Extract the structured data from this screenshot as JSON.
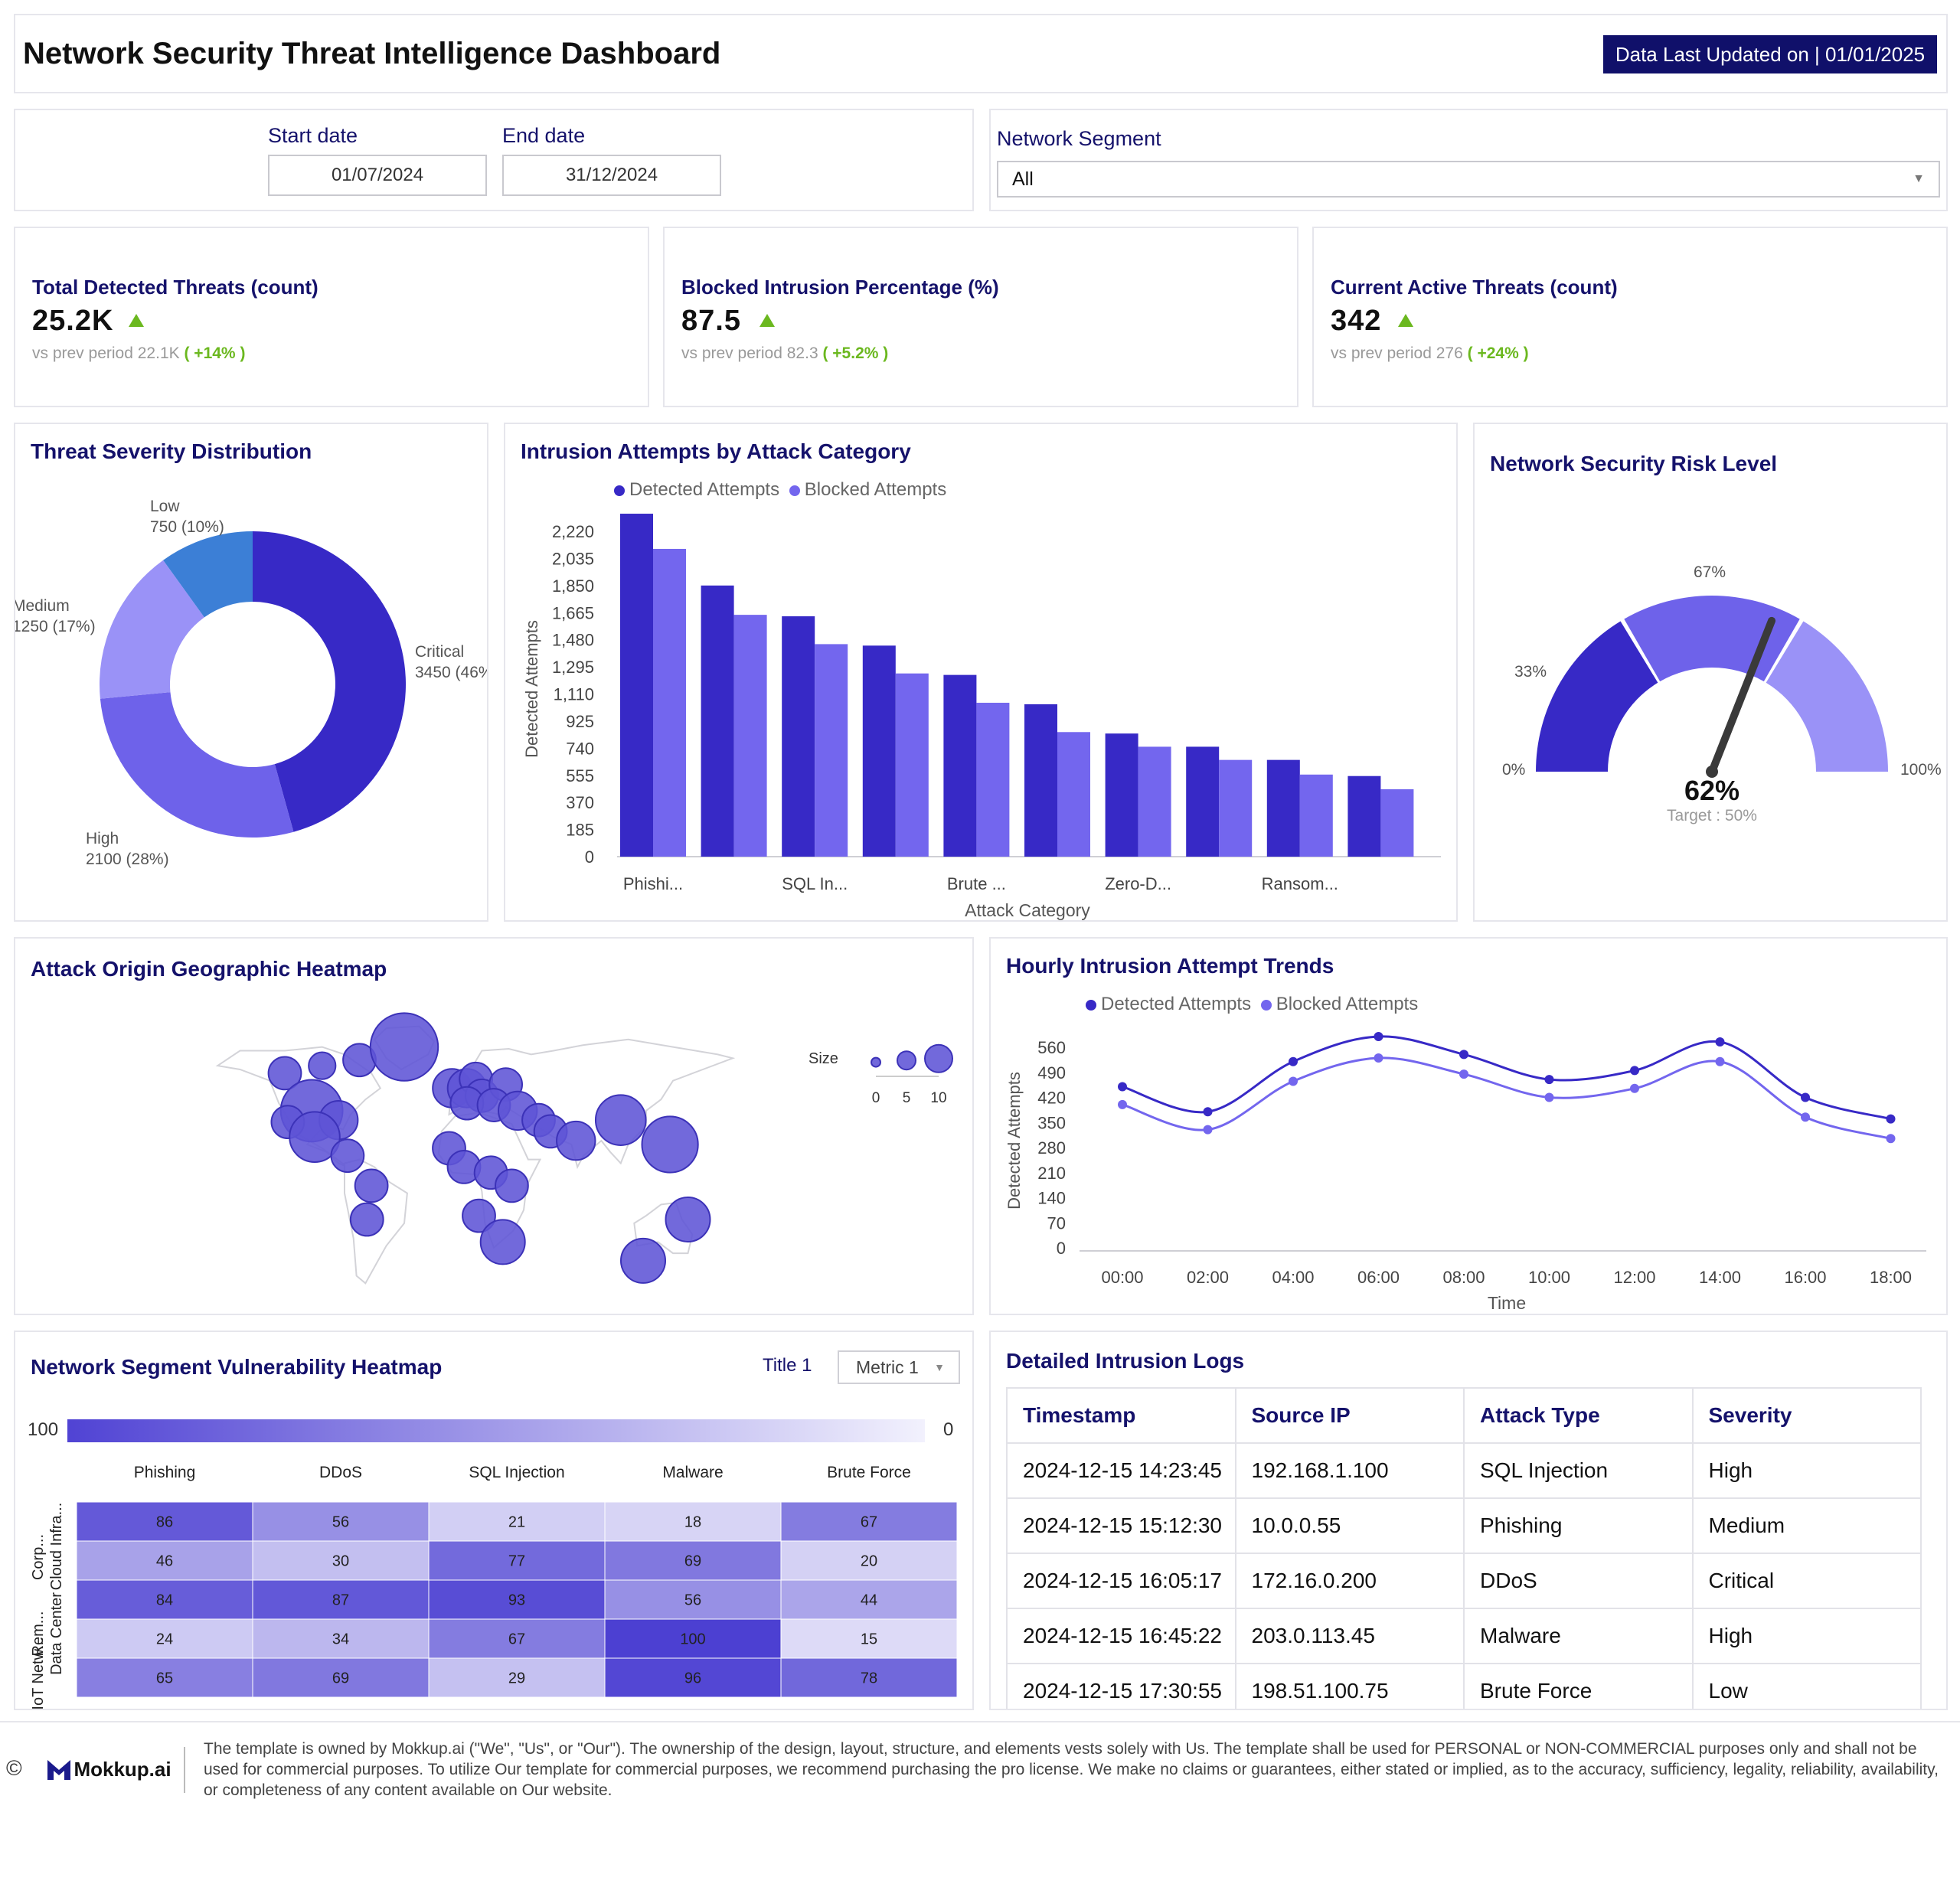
{
  "header": {
    "title": "Network Security Threat Intelligence Dashboard",
    "updated": "Data Last Updated on | 01/01/2025"
  },
  "filters": {
    "start_label": "Start date",
    "start_value": "01/07/2024",
    "end_label": "End date",
    "end_value": "31/12/2024",
    "segment_label": "Network Segment",
    "segment_value": "All"
  },
  "kpis": [
    {
      "label": "Total Detected Threats (count)",
      "value": "25.2K",
      "prev_text": "vs prev period",
      "prev_value": "22.1K",
      "change": "( +14% )"
    },
    {
      "label": "Blocked Intrusion Percentage (%)",
      "value": "87.5",
      "prev_text": "vs prev period",
      "prev_value": "82.3",
      "change": "( +5.2% )"
    },
    {
      "label": "Current Active Threats (count)",
      "value": "342",
      "prev_text": "vs prev period",
      "prev_value": "276",
      "change": "( +24% )"
    }
  ],
  "colors": {
    "navy": "#15126b",
    "primary": "#3729c6",
    "secondary": "#7366ee",
    "light": "#9a92f7",
    "blue": "#3c7fd6",
    "green": "#6bb81f",
    "needle": "#3a3a3a"
  },
  "severity": {
    "title": "Threat Severity Distribution",
    "chart_data": {
      "type": "pie",
      "style": "donut",
      "slices": [
        {
          "label": "Critical",
          "value": 3450,
          "text": "3450 (46%)",
          "color": "#3729c6"
        },
        {
          "label": "High",
          "value": 2100,
          "text": "2100 (28%)",
          "color": "#6e62ea"
        },
        {
          "label": "Medium",
          "value": 1250,
          "text": "1250 (17%)",
          "color": "#9a92f7"
        },
        {
          "label": "Low",
          "value": 750,
          "text": "750 (10%)",
          "color": "#3c7fd6"
        }
      ]
    }
  },
  "attacks": {
    "title": "Intrusion Attempts by Attack Category",
    "legend": [
      "Detected Attempts",
      "Blocked Attempts"
    ],
    "chart_data": {
      "type": "bar",
      "xlabel": "Attack Category",
      "ylabel": "Detected Attempts",
      "yticks": [
        "0",
        "185",
        "370",
        "555",
        "740",
        "925",
        "1,110",
        "1,295",
        "1,480",
        "1,665",
        "1,850",
        "2,035",
        "2,220"
      ],
      "ylim": [
        0,
        2220
      ],
      "categories": [
        "Phishi...",
        "",
        "SQL In...",
        "",
        "Brute ...",
        "",
        "Zero-D...",
        "",
        "Ransom...",
        ""
      ],
      "series": [
        {
          "name": "Detected Attempts",
          "values": [
            2340,
            1850,
            1640,
            1440,
            1240,
            1040,
            840,
            750,
            660,
            550
          ]
        },
        {
          "name": "Blocked Attempts",
          "values": [
            2100,
            1650,
            1450,
            1250,
            1050,
            850,
            750,
            660,
            560,
            460
          ]
        }
      ]
    }
  },
  "risk": {
    "title": "Network Security Risk Level",
    "value_text": "62%",
    "target_text": "Target : 50%",
    "labels": [
      "0%",
      "33%",
      "67%",
      "100%"
    ],
    "chart_data": {
      "type": "gauge",
      "value": 62,
      "target": 50,
      "range": [
        0,
        100
      ],
      "bands": [
        {
          "from": 0,
          "to": 33,
          "color": "#3729c6"
        },
        {
          "from": 33,
          "to": 67,
          "color": "#6e62ea"
        },
        {
          "from": 67,
          "to": 100,
          "color": "#9a92f7"
        }
      ]
    }
  },
  "geo": {
    "title": "Attack Origin Geographic Heatmap",
    "size_label": "Size",
    "size_ticks": [
      "0",
      "5",
      "10"
    ],
    "chart_data": {
      "type": "scatter",
      "map": "world",
      "points": [
        {
          "lon": -120,
          "lat": 58,
          "size": 3
        },
        {
          "lon": -95,
          "lat": 62,
          "size": 2
        },
        {
          "lon": -102,
          "lat": 38,
          "size": 8
        },
        {
          "lon": -118,
          "lat": 32,
          "size": 3
        },
        {
          "lon": -84,
          "lat": 33,
          "size": 4
        },
        {
          "lon": -100,
          "lat": 24,
          "size": 6
        },
        {
          "lon": -78,
          "lat": 14,
          "size": 3
        },
        {
          "lon": -62,
          "lat": -2,
          "size": 3
        },
        {
          "lon": -65,
          "lat": -20,
          "size": 3
        },
        {
          "lon": -70,
          "lat": 65,
          "size": 3
        },
        {
          "lon": -40,
          "lat": 72,
          "size": 9
        },
        {
          "lon": -8,
          "lat": 50,
          "size": 4
        },
        {
          "lon": 2,
          "lat": 50,
          "size": 4
        },
        {
          "lon": 8,
          "lat": 55,
          "size": 3
        },
        {
          "lon": 12,
          "lat": 46,
          "size": 3
        },
        {
          "lon": 28,
          "lat": 52,
          "size": 3
        },
        {
          "lon": 2,
          "lat": 42,
          "size": 3
        },
        {
          "lon": 20,
          "lat": 41,
          "size": 3
        },
        {
          "lon": 36,
          "lat": 38,
          "size": 4
        },
        {
          "lon": 50,
          "lat": 33,
          "size": 3
        },
        {
          "lon": 58,
          "lat": 27,
          "size": 3
        },
        {
          "lon": 75,
          "lat": 22,
          "size": 4
        },
        {
          "lon": 105,
          "lat": 33,
          "size": 6
        },
        {
          "lon": 138,
          "lat": 20,
          "size": 7
        },
        {
          "lon": -10,
          "lat": 18,
          "size": 3
        },
        {
          "lon": 0,
          "lat": 8,
          "size": 3
        },
        {
          "lon": 18,
          "lat": 5,
          "size": 3
        },
        {
          "lon": 32,
          "lat": -2,
          "size": 3
        },
        {
          "lon": 10,
          "lat": -18,
          "size": 3
        },
        {
          "lon": 26,
          "lat": -32,
          "size": 5
        },
        {
          "lon": 150,
          "lat": -20,
          "size": 5
        },
        {
          "lon": 120,
          "lat": -42,
          "size": 5
        }
      ]
    }
  },
  "hourly": {
    "title": "Hourly Intrusion Attempt Trends",
    "legend": [
      "Detected Attempts",
      "Blocked Attempts"
    ],
    "chart_data": {
      "type": "line",
      "xlabel": "Time",
      "ylabel": "Detected Attempts",
      "x": [
        "00:00",
        "02:00",
        "04:00",
        "06:00",
        "08:00",
        "10:00",
        "12:00",
        "14:00",
        "16:00",
        "18:00"
      ],
      "yticks": [
        "0",
        "70",
        "140",
        "210",
        "280",
        "350",
        "420",
        "490",
        "560"
      ],
      "ylim": [
        0,
        560
      ],
      "series": [
        {
          "name": "Detected Attempts",
          "values": [
            450,
            380,
            520,
            590,
            540,
            470,
            495,
            575,
            420,
            360
          ]
        },
        {
          "name": "Blocked Attempts",
          "values": [
            400,
            330,
            465,
            530,
            485,
            420,
            445,
            520,
            365,
            305
          ]
        }
      ]
    }
  },
  "vuln": {
    "title": "Network Segment Vulnerability Heatmap",
    "title1": "Title 1",
    "metric": "Metric 1",
    "scale_max": "100",
    "scale_min": "0",
    "chart_data": {
      "type": "heatmap",
      "columns": [
        "Phishing",
        "DDoS",
        "SQL Injection",
        "Malware",
        "Brute Force"
      ],
      "rows": [
        "Corp...",
        "Cloud Infra...",
        "Rem...",
        "Data Center",
        "IoT Netw..."
      ],
      "values": [
        [
          86,
          56,
          21,
          18,
          67
        ],
        [
          46,
          30,
          77,
          69,
          20
        ],
        [
          84,
          87,
          93,
          56,
          44
        ],
        [
          24,
          34,
          67,
          100,
          15
        ],
        [
          65,
          69,
          29,
          96,
          78
        ]
      ]
    }
  },
  "logs": {
    "title": "Detailed Intrusion Logs",
    "columns": [
      "Timestamp",
      "Source IP",
      "Attack Type",
      "Severity"
    ],
    "rows": [
      [
        "2024-12-15 14:23:45",
        "192.168.1.100",
        "SQL Injection",
        "High"
      ],
      [
        "2024-12-15 15:12:30",
        "10.0.0.55",
        "Phishing",
        "Medium"
      ],
      [
        "2024-12-15 16:05:17",
        "172.16.0.200",
        "DDoS",
        "Critical"
      ],
      [
        "2024-12-15 16:45:22",
        "203.0.113.45",
        "Malware",
        "High"
      ],
      [
        "2024-12-15 17:30:55",
        "198.51.100.75",
        "Brute Force",
        "Low"
      ]
    ]
  },
  "footer": {
    "copyright": "©",
    "brand": "Mokkup.ai",
    "text": "The template is owned by Mokkup.ai (\"We\", \"Us\", or \"Our\"). The ownership of the design, layout, structure, and elements vests solely with Us. The template shall be used for PERSONAL or NON-COMMERCIAL purposes only and shall not be used for commercial purposes. To utilize Our template for commercial purposes, we recommend purchasing the pro license. We make no claims or guarantees, either stated or implied, as to the accuracy, sufficiency, legality, reliability, availability, or completeness of any content available on Our website."
  }
}
